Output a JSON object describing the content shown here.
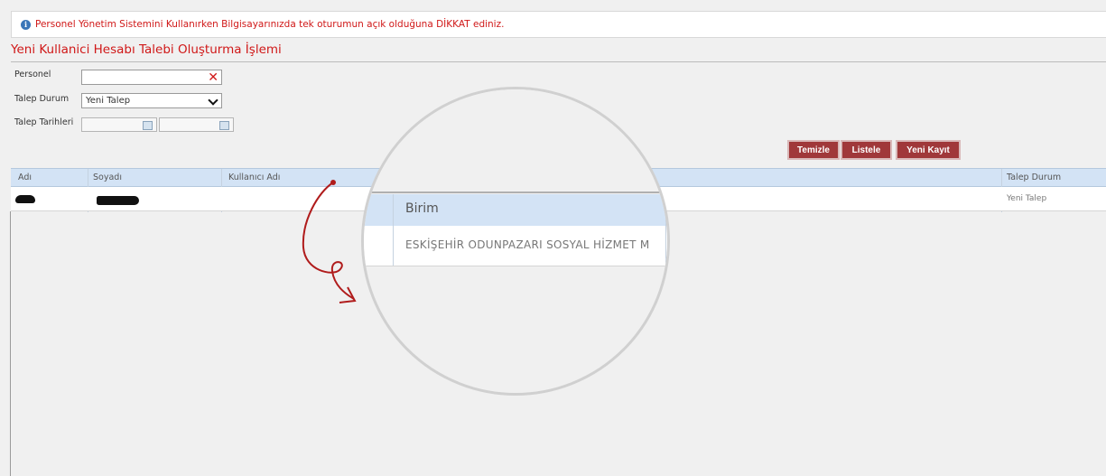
{
  "notice": {
    "icon": "info-icon",
    "text": "Personel Yönetim Sistemini Kullanırken Bilgisayarınızda tek oturumun açık olduğuna DİKKAT ediniz."
  },
  "page_title": "Yeni Kullanici Hesabı Talebi Oluşturma İşlemi",
  "form": {
    "personel_label": "Personel",
    "personel_value": "",
    "talep_durum_label": "Talep Durum",
    "talep_durum_value": "Yeni Talep",
    "talep_tarihleri_label": "Talep Tarihleri"
  },
  "buttons": {
    "temizle": "Temizle",
    "listele": "Listele",
    "yeni_kayit": "Yeni Kayıt"
  },
  "table": {
    "columns": [
      "Adı",
      "Soyadı",
      "Kullanıcı Adı",
      "Talep Durum"
    ],
    "rows": [
      {
        "adi": "",
        "soyadi": "",
        "kullanici_adi": "",
        "talep_durum": "Yeni Talep"
      }
    ]
  },
  "magnifier": {
    "column": "Birim",
    "value": "ESKİŞEHİR ODUNPAZARI SOSYAL HİZMET M"
  },
  "colors": {
    "accent_red": "#d01818",
    "button_red": "#a0383a",
    "header_blue": "#d3e3f5"
  }
}
